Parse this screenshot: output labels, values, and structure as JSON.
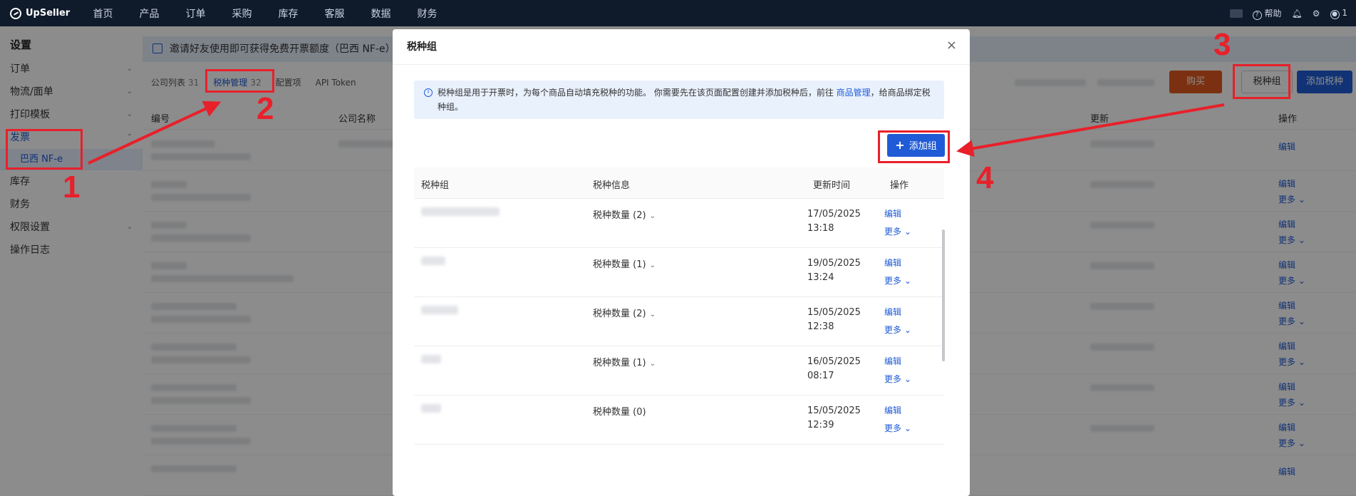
{
  "topnav": {
    "logo": "UpSeller",
    "items": [
      "首页",
      "产品",
      "订单",
      "采购",
      "库存",
      "客服",
      "数据",
      "财务"
    ],
    "help": "帮助",
    "user_short": "1"
  },
  "sidebar": {
    "title": "设置",
    "items": [
      {
        "label": "订单",
        "chevron": true
      },
      {
        "label": "物流/面单",
        "chevron": true
      },
      {
        "label": "打印模板",
        "chevron": true
      },
      {
        "label": "发票",
        "chevron": true
      },
      {
        "label": "库存",
        "chevron": false
      },
      {
        "label": "财务",
        "chevron": false
      },
      {
        "label": "权限设置",
        "chevron": true
      },
      {
        "label": "操作日志",
        "chevron": false
      }
    ],
    "sub_item": "巴西 NF-e"
  },
  "main": {
    "banner": "邀请好友使用即可获得免费开票额度（巴西 NF-e）",
    "tabs": [
      {
        "label": "公司列表",
        "count": "31"
      },
      {
        "label": "税种管理",
        "count": "32"
      },
      {
        "label": "配置项",
        "count": ""
      },
      {
        "label": "API Token",
        "count": ""
      }
    ],
    "buy_button": "购买",
    "tax_group_button": "税种组",
    "add_tax_button": "添加税种",
    "columns": {
      "id": "编号",
      "company": "公司名称",
      "updated": "更新",
      "action": "操作"
    },
    "row_edit": "编辑",
    "row_more": "更多"
  },
  "modal": {
    "title": "税种组",
    "close": "×",
    "notice_text_1": "税种组是用于开票时，为每个商品自动填充税种的功能。 你需要先在该页面配置创建并添加税种后，前往",
    "notice_link": "商品管理",
    "notice_text_2": "，给商品绑定税种组。",
    "add_group_label": "添加组",
    "columns": {
      "group": "税种组",
      "tax_info": "税种信息",
      "updated": "更新时间",
      "action": "操作"
    },
    "rows": [
      {
        "tax_info": "税种数量 (2)",
        "has_dropdown": true,
        "date": "17/05/2025",
        "time": "13:18",
        "edit": "编辑",
        "more": "更多"
      },
      {
        "tax_info": "税种数量 (1)",
        "has_dropdown": true,
        "date": "19/05/2025",
        "time": "13:24",
        "edit": "编辑",
        "more": "更多"
      },
      {
        "tax_info": "税种数量 (2)",
        "has_dropdown": true,
        "date": "15/05/2025",
        "time": "12:38",
        "edit": "编辑",
        "more": "更多"
      },
      {
        "tax_info": "税种数量 (1)",
        "has_dropdown": true,
        "date": "16/05/2025",
        "time": "08:17",
        "edit": "编辑",
        "more": "更多"
      },
      {
        "tax_info": "税种数量 (0)",
        "has_dropdown": false,
        "date": "15/05/2025",
        "time": "12:39",
        "edit": "编辑",
        "more": "更多"
      }
    ]
  },
  "annotations": {
    "labels": [
      "1",
      "2",
      "3",
      "4"
    ],
    "color": "#e8202a"
  },
  "colors": {
    "primary": "#1f5bd6",
    "buy": "#e05a1f",
    "nav_bg": "#0f1a2b"
  }
}
